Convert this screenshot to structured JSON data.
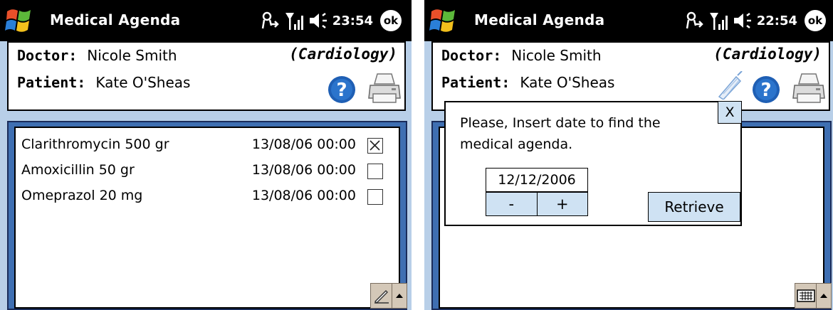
{
  "colors": {
    "titlebar_bg": "#000000",
    "screen_bg": "#b8cfe8",
    "list_frame": "#3f6fb2",
    "help_blue": "#1f5fb4",
    "button_bg": "#cfe2f3"
  },
  "screens": [
    {
      "titlebar": {
        "start_icon": "windows-flag-icon",
        "title": "Medical Agenda",
        "time": "23:54",
        "ok_label": "ok"
      },
      "header": {
        "doctor_label": "Doctor:",
        "doctor_name": "Nicole Smith",
        "specialty": "(Cardiology)",
        "patient_label": "Patient:",
        "patient_name": "Kate O'Sheas"
      },
      "medications": [
        {
          "name": "Clarithromycin 500 gr",
          "datetime": "13/08/06 00:00",
          "checked": true
        },
        {
          "name": "Amoxicillin 50 gr",
          "datetime": "13/08/06 00:00",
          "checked": false
        },
        {
          "name": "Omeprazol 20 mg",
          "datetime": "13/08/06 00:00",
          "checked": false
        }
      ],
      "sip_icon": "pen-input-icon"
    },
    {
      "titlebar": {
        "start_icon": "windows-flag-icon",
        "title": "Medical Agenda",
        "time": "22:54",
        "ok_label": "ok"
      },
      "header": {
        "doctor_label": "Doctor:",
        "doctor_name": "Nicole Smith",
        "specialty": "(Cardiology)",
        "patient_label": "Patient:",
        "patient_name": "Kate O'Sheas"
      },
      "dialog": {
        "close_label": "X",
        "message": "Please, Insert date to find the medical agenda.",
        "date_value": "12/12/2006",
        "minus_label": "-",
        "plus_label": "+",
        "retrieve_label": "Retrieve"
      },
      "sip_icon": "keyboard-icon"
    }
  ]
}
